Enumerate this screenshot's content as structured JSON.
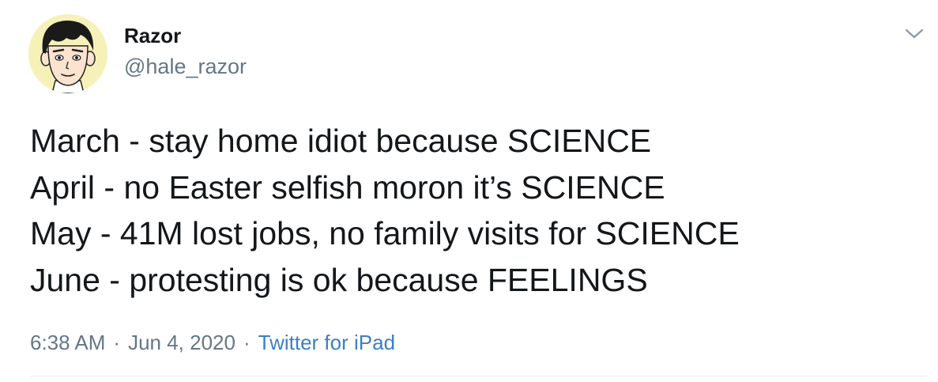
{
  "user": {
    "display_name": "Razor",
    "handle": "@hale_razor",
    "avatar_icon": "cartoon-face-avatar"
  },
  "menu": {
    "icon": "chevron-down-icon"
  },
  "tweet": {
    "lines": [
      "March - stay home idiot because SCIENCE",
      "April - no Easter selfish moron it’s SCIENCE",
      "May - 41M lost jobs, no family visits for SCIENCE",
      "June - protesting is ok because FEELINGS"
    ]
  },
  "meta": {
    "time": "6:38 AM",
    "separator": "·",
    "date": "Jun 4, 2020",
    "source": "Twitter for iPad"
  },
  "colors": {
    "text": "#14171a",
    "secondary": "#657786",
    "link": "#3b7fc4"
  }
}
